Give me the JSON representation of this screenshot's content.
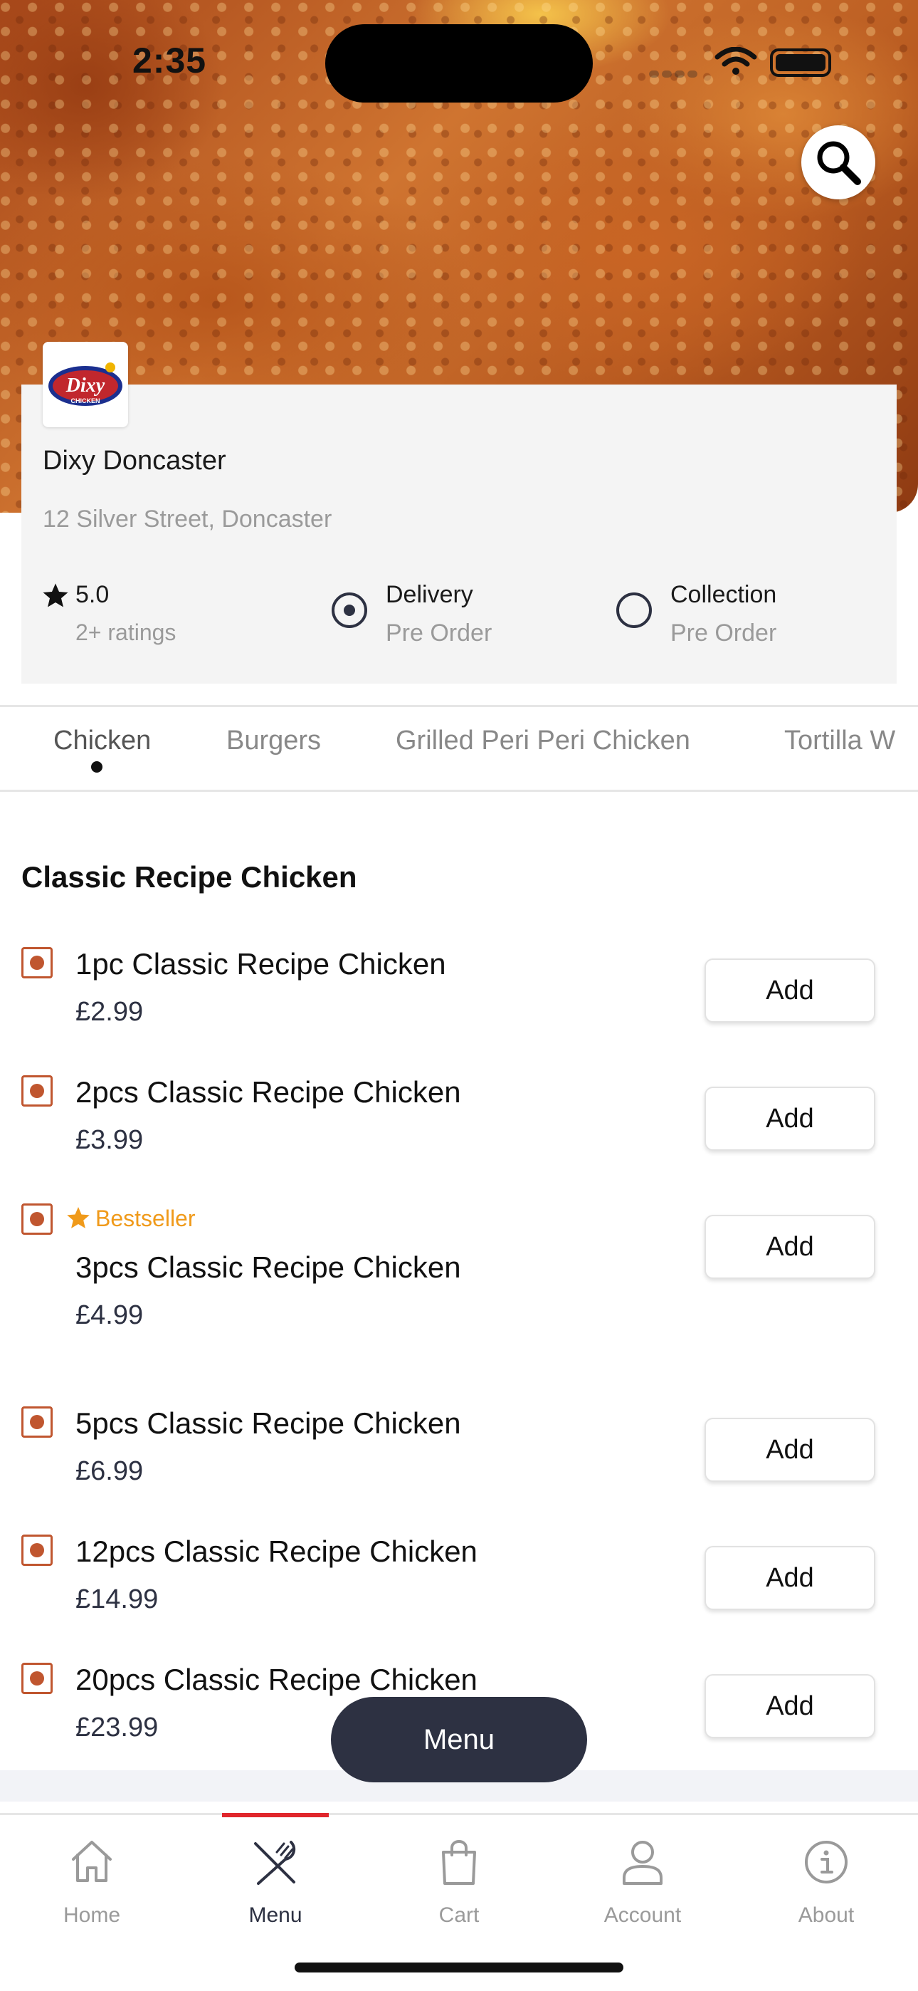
{
  "status_bar": {
    "time": "2:35"
  },
  "store": {
    "logo_text": "Dixy",
    "logo_subtext": "CHICKEN",
    "name": "Dixy Doncaster",
    "address": "12 Silver Street, Doncaster",
    "rating": "5.0",
    "rating_count": "2+ ratings"
  },
  "order_options": [
    {
      "title": "Delivery",
      "subtitle": "Pre Order",
      "selected": true
    },
    {
      "title": "Collection",
      "subtitle": "Pre Order",
      "selected": false
    }
  ],
  "categories": [
    "Chicken",
    "Burgers",
    "Grilled Peri Peri Chicken",
    "Tortilla W"
  ],
  "active_category": "Chicken",
  "section": {
    "title": "Classic Recipe Chicken",
    "add_label": "Add",
    "bestseller_label": "Bestseller",
    "items": [
      {
        "name": "1pc Classic Recipe Chicken",
        "price": "£2.99",
        "bestseller": false
      },
      {
        "name": "2pcs Classic Recipe Chicken",
        "price": "£3.99",
        "bestseller": false
      },
      {
        "name": "3pcs Classic Recipe Chicken",
        "price": "£4.99",
        "bestseller": true
      },
      {
        "name": "5pcs Classic Recipe Chicken",
        "price": "£6.99",
        "bestseller": false
      },
      {
        "name": "12pcs Classic Recipe Chicken",
        "price": "£14.99",
        "bestseller": false
      },
      {
        "name": "20pcs Classic Recipe Chicken",
        "price": "£23.99",
        "bestseller": false
      }
    ]
  },
  "menu_button": "Menu",
  "bottom_nav": [
    {
      "label": "Home",
      "icon": "home-icon"
    },
    {
      "label": "Menu",
      "icon": "fork-knife-icon",
      "active": true
    },
    {
      "label": "Cart",
      "icon": "shopping-bag-icon"
    },
    {
      "label": "Account",
      "icon": "user-icon"
    },
    {
      "label": "About",
      "icon": "info-icon"
    }
  ],
  "colors": {
    "accent_dark": "#2d3142",
    "active_tab_bar": "#e0262c",
    "bestseller": "#f09a1a",
    "veg_marker": "#c0562f"
  }
}
